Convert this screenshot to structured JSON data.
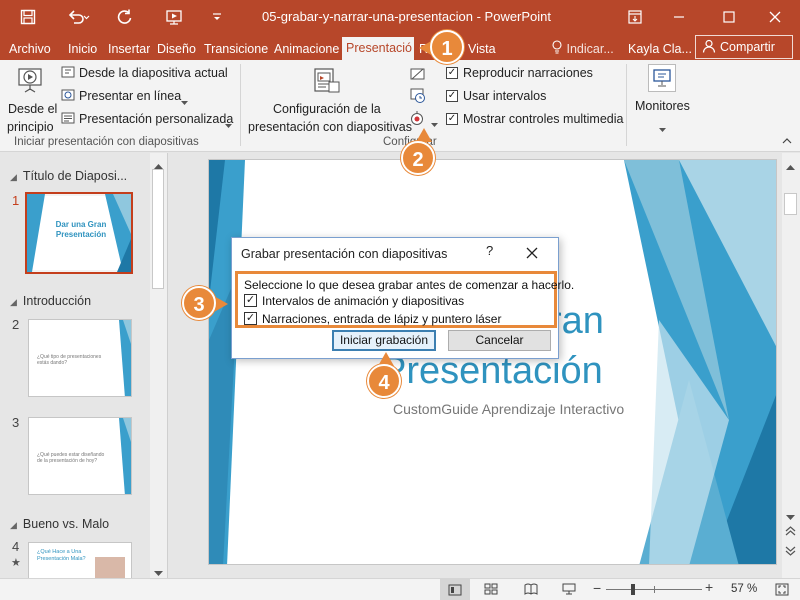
{
  "window": {
    "doc_title": "05-grabar-y-narrar-una-presentacion  -  PowerPoint"
  },
  "tabs": [
    {
      "label": "Archivo"
    },
    {
      "label": "Inicio"
    },
    {
      "label": "Insertar"
    },
    {
      "label": "Diseño"
    },
    {
      "label": "Transicione"
    },
    {
      "label": "Animacione"
    },
    {
      "label": "Presentació"
    },
    {
      "label": "R"
    },
    {
      "label": "Vista"
    }
  ],
  "tell_me": "Indicar...",
  "user": "Kayla Cla...",
  "share_label": "Compartir",
  "ribbon": {
    "desde_principio": [
      "Desde el",
      "principio"
    ],
    "desde_actual": "Desde la diapositiva actual",
    "en_linea": "Presentar en línea",
    "personalizada": "Presentación personalizada",
    "group_iniciar": "Iniciar presentación con diapositivas",
    "config": [
      "Configuración de la",
      "presentación con diapositivas"
    ],
    "reproducir": "Reproducir narraciones",
    "intervalos": "Usar intervalos",
    "controles": "Mostrar controles multimedia",
    "group_configurar": "Configurar",
    "monitores": "Monitores"
  },
  "slides_panel": {
    "sections": [
      {
        "title": "Título de Diaposi..."
      },
      {
        "title": "Introducción"
      },
      {
        "title": "Bueno vs. Malo"
      }
    ],
    "slides": [
      {
        "num": "1",
        "text": "Dar una Gran Presentación"
      },
      {
        "num": "2",
        "text": "¿Qué tipo de presentaciones estás dando?"
      },
      {
        "num": "3",
        "text": "¿Qué puedes estar diseñando de la presentación de hoy?"
      },
      {
        "num": "4",
        "text": "¿Qué Hace a Una Presentación Mala?"
      }
    ]
  },
  "slide": {
    "title_line1": "ran",
    "title_line2": "Presentación",
    "subtitle": "CustomGuide Aprendizaje Interactivo"
  },
  "dialog": {
    "title": "Grabar presentación con diapositivas",
    "help": "?",
    "prompt": "Seleccione lo que desea grabar antes de comenzar a hacerlo.",
    "option1": "Intervalos de animación y diapositivas",
    "option2": "Narraciones, entrada de lápiz y puntero láser",
    "start_btn": "Iniciar grabación",
    "cancel_btn": "Cancelar"
  },
  "status": {
    "zoom": "57 %"
  },
  "callouts": [
    "1",
    "2",
    "3",
    "4"
  ],
  "colors": {
    "titlebar": "#b7472a",
    "accent": "#e8893a",
    "slide_blue": "#2f93bf"
  }
}
